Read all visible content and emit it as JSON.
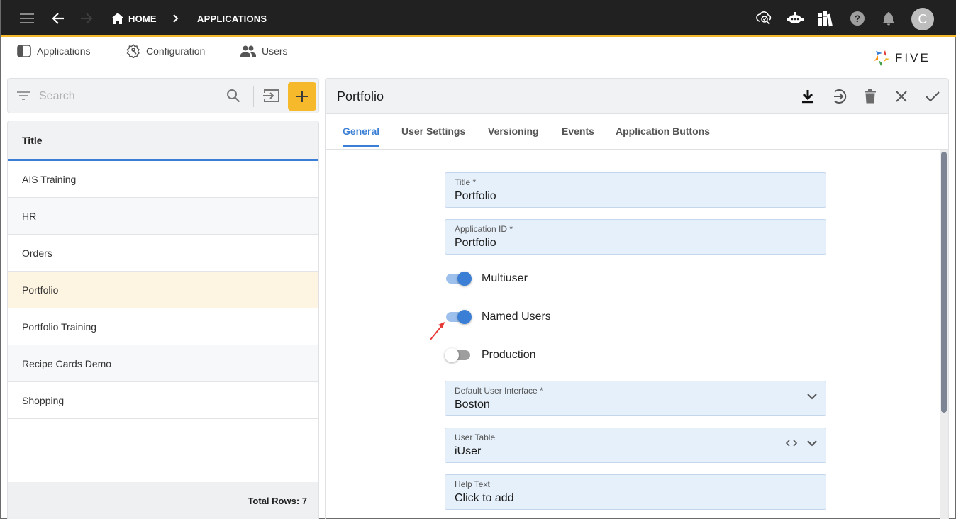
{
  "topbar": {
    "breadcrumbs": [
      "HOME",
      "APPLICATIONS"
    ],
    "avatar_initial": "C",
    "icons": [
      "menu-icon",
      "back-arrow-icon",
      "forward-arrow-icon",
      "home-icon",
      "cloud-search-icon",
      "chatbot-icon",
      "library-icon",
      "help-icon",
      "bell-icon"
    ],
    "accent_color": "#f6b92b"
  },
  "menu": {
    "items": [
      {
        "label": "Applications",
        "icon": "applications-icon"
      },
      {
        "label": "Configuration",
        "icon": "configuration-icon"
      },
      {
        "label": "Users",
        "icon": "users-icon"
      }
    ]
  },
  "logo": {
    "text": "FIVE"
  },
  "search": {
    "placeholder": "Search"
  },
  "list": {
    "header": "Title",
    "rows": [
      "AIS Training",
      "HR",
      "Orders",
      "Portfolio",
      "Portfolio Training",
      "Recipe Cards Demo",
      "Shopping"
    ],
    "selected": "Portfolio",
    "footer": "Total Rows: 7"
  },
  "form": {
    "title": "Portfolio",
    "actions": [
      "download-icon",
      "next-icon",
      "delete-icon",
      "close-icon",
      "check-icon"
    ],
    "tabs": [
      "General",
      "User Settings",
      "Versioning",
      "Events",
      "Application Buttons"
    ],
    "active_tab": "General",
    "fields": {
      "title": {
        "label": "Title *",
        "value": "Portfolio"
      },
      "application_id": {
        "label": "Application ID *",
        "value": "Portfolio"
      },
      "default_ui": {
        "label": "Default User Interface *",
        "value": "Boston"
      },
      "user_table": {
        "label": "User Table",
        "value": "iUser"
      },
      "help_text": {
        "label": "Help Text",
        "value": "Click to add"
      }
    },
    "toggles": {
      "multiuser": {
        "label": "Multiuser",
        "on": true
      },
      "named_users": {
        "label": "Named Users",
        "on": true
      },
      "production": {
        "label": "Production",
        "on": false
      }
    },
    "accent_color": "#3a7fd5"
  }
}
